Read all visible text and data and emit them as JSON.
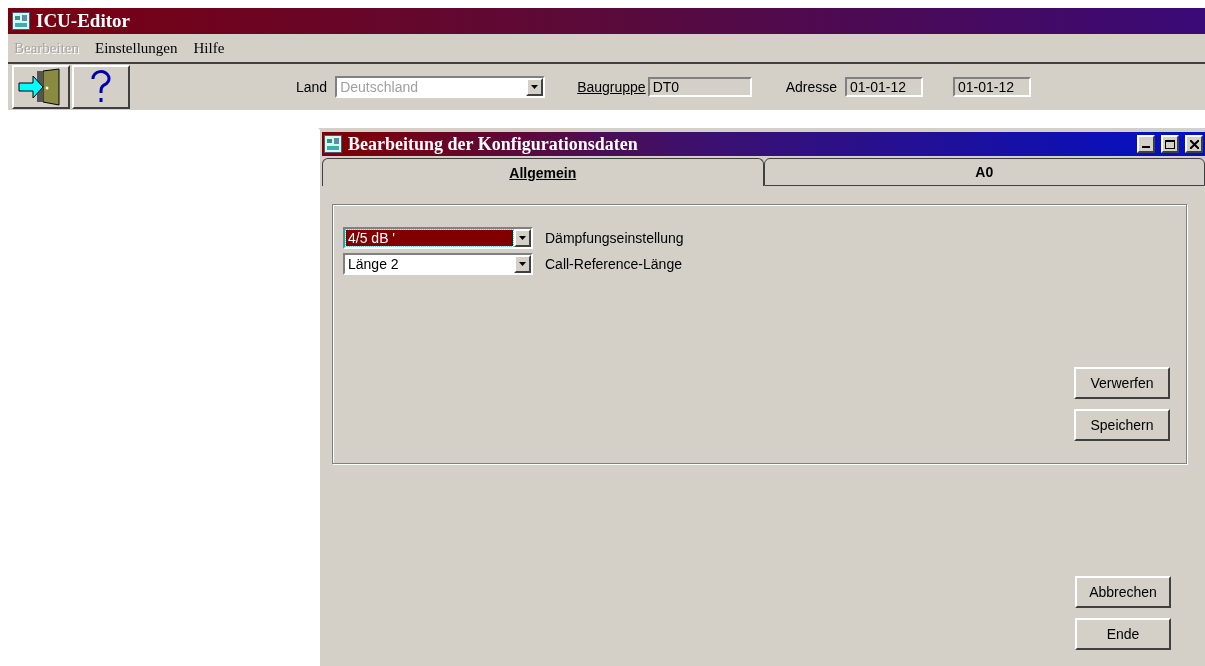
{
  "window": {
    "title": "ICU-Editor"
  },
  "menu": [
    {
      "label": "Bearbeiten",
      "disabled": true
    },
    {
      "label": "Einstellungen",
      "disabled": false
    },
    {
      "label": "Hilfe",
      "disabled": false
    }
  ],
  "toolbar": {
    "land": {
      "label": "Land",
      "value": "Deutschland",
      "disabled": true
    },
    "baugruppe": {
      "label": "Baugruppe",
      "value": "DT0"
    },
    "adresse": {
      "label": "Adresse",
      "values": [
        "01-01-12",
        "01-01-12"
      ]
    }
  },
  "dialog": {
    "title": "Bearbeitung der Konfigurationsdaten",
    "tabs": [
      {
        "label": "Allgemein",
        "selected": true
      },
      {
        "label": "A0",
        "selected": false
      }
    ],
    "settings": [
      {
        "value": "4/5 dB '",
        "label": "Dämpfungseinstellung",
        "focused": true
      },
      {
        "value": "Länge 2",
        "label": "Call-Reference-Länge",
        "focused": false
      }
    ],
    "panel_buttons": [
      "Verwerfen",
      "Speichern"
    ],
    "buttons": [
      "Abbrechen",
      "Ende"
    ]
  }
}
